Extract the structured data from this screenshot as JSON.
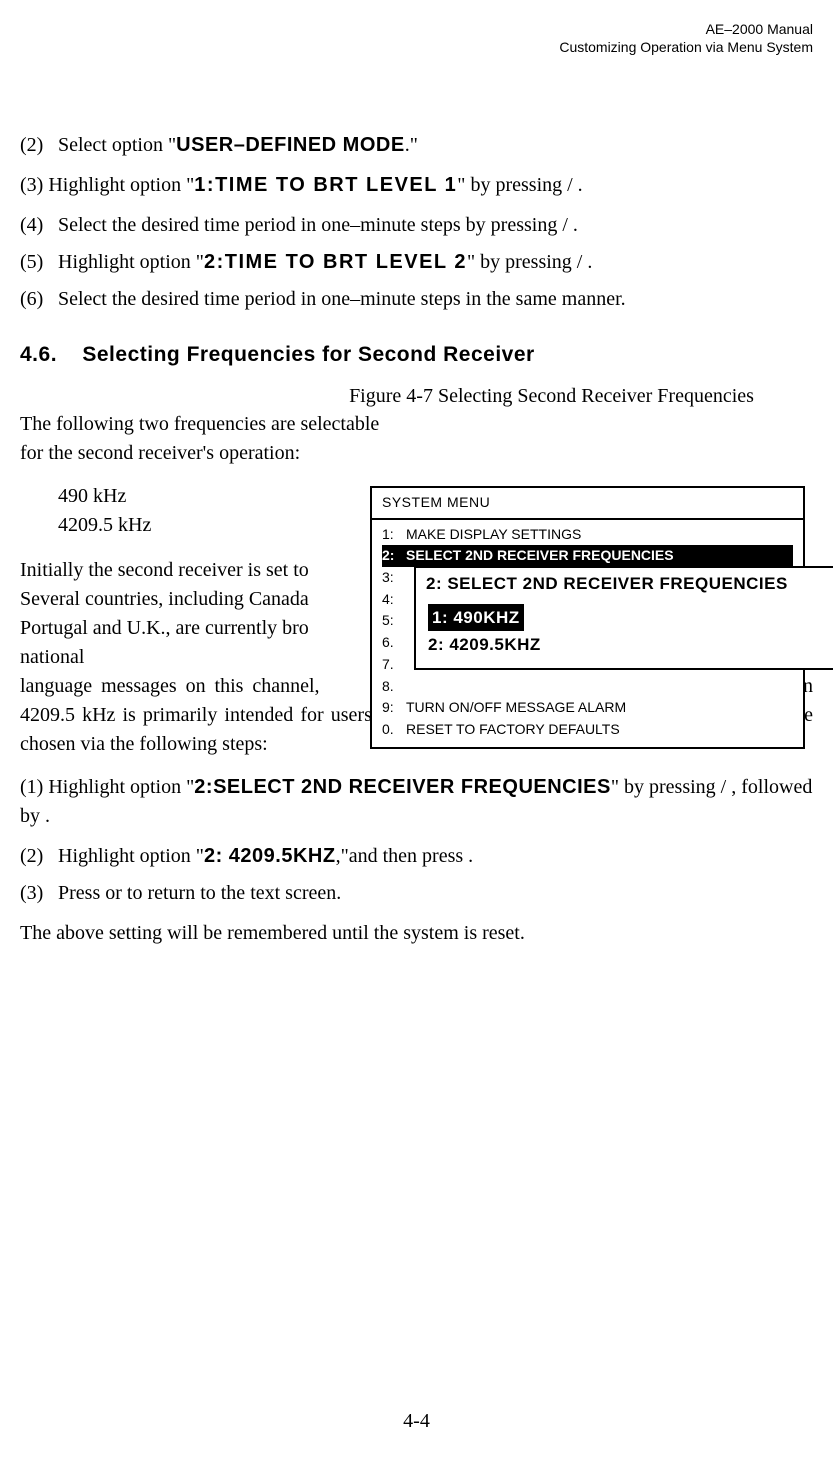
{
  "header": {
    "line1": "AE–2000 Manual",
    "line2": "Customizing Operation via Menu System"
  },
  "steps_a": {
    "s2_num": "(2)",
    "s2_a": "Select option \"",
    "s2_b": "USER–DEFINED MODE",
    "s2_c": ".\"",
    "s3_num": "(3)",
    "s3_a": "Highlight option \"",
    "s3_b": "1:TIME  TO BRT LEVEL 1",
    "s3_c": "\" by pressing       /      .",
    "s4_num": "(4)",
    "s4_body": "Select the desired time period in one–minute steps by pressing    /    .",
    "s5_num": "(5)",
    "s5_a": "Highlight option \"",
    "s5_b": "2:TIME  TO BRT LEVEL 2",
    "s5_c": "\" by pressing       /      .",
    "s6_num": "(6)",
    "s6_body": "Select the desired time period in one–minute steps in the same manner."
  },
  "section": {
    "num": "4.6.",
    "title": "Selecting Frequencies for Second Receiver"
  },
  "fig_caption": "Figure 4-7   Selecting Second Receiver Frequencies",
  "body": {
    "p1": "The following two frequencies are selectable for the second receiver's operation:",
    "freq1": "490 kHz",
    "freq2": "4209.5 kHz",
    "p2a": "Initially the second receiver is set to",
    "p2b": "Several countries, including   Canada",
    "p2c": "Portugal and U.K., are currently bro",
    "p2d": "national",
    "p2e_a": "language messages on this channel, ",
    "p2e_b": " service on 4209.5 kHz is primarily intended for users in tropical regions. This shortwave frequency can be chosen via the following steps:"
  },
  "steps_b": {
    "s1_num": "(1)",
    "s1_a": "Highlight option \"",
    "s1_b": "2:SELECT 2ND RECEIVER FREQUENCIES",
    "s1_c": "\" by pressing        /       , followed by       .",
    "s2_num": "(2)",
    "s2_a": "Highlight option \"",
    "s2_b": "2: 4209.5KHZ",
    "s2_c": ",\"and then press       .",
    "s3_num": "(3)",
    "s3_body": "Press        or        to return to the text screen."
  },
  "closing": "The above setting will be remembered until the system is reset.",
  "menu1": {
    "title": "SYSTEM MENU",
    "r1n": "1:",
    "r1": "MAKE DISPLAY SETTINGS",
    "r2n": "2:",
    "r2": "SELECT 2ND RECEIVER FREQUENCIES",
    "r3n": "3:",
    "r4n": "4:",
    "r5n": "5:",
    "r6n": "6.",
    "r7n": "7.",
    "r8n": "8.",
    "r9n": "9:",
    "r9": "TURN ON/OFF MESSAGE ALARM",
    "r0n": "0.",
    "r0": "RESET TO FACTORY DEFAULTS"
  },
  "menu2": {
    "title": "2: SELECT 2ND RECEIVER FREQUENCIES",
    "opt1": "1: 490KHZ",
    "opt2": "2: 4209.5KHZ"
  },
  "page_num": "4-4"
}
